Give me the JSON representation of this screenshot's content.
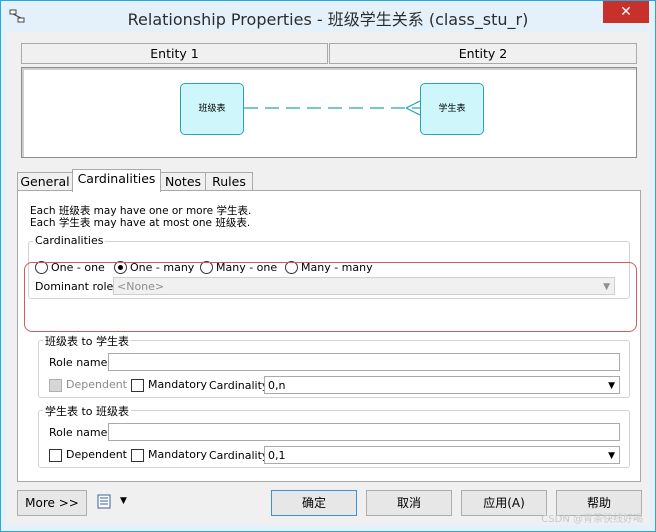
{
  "window": {
    "title": "Relationship Properties - 班级学生关系 (class_stu_r)",
    "close_glyph": "✕"
  },
  "entities": {
    "entity1_header": "Entity 1",
    "entity2_header": "Entity 2",
    "entity1_name": "班级表",
    "entity2_name": "学生表"
  },
  "tabs": [
    {
      "label": "General"
    },
    {
      "label": "Cardinalities"
    },
    {
      "label": "Notes"
    },
    {
      "label": "Rules"
    }
  ],
  "active_tab": "Cardinalities",
  "description": {
    "line1": "Each 班级表 may have one or more 学生表.",
    "line2": "Each 学生表 may have at most one 班级表."
  },
  "cardinalities": {
    "group_label": "Cardinalities",
    "options": [
      {
        "label": "One - one",
        "checked": false
      },
      {
        "label": "One - many",
        "checked": true
      },
      {
        "label": "Many - one",
        "checked": false
      },
      {
        "label": "Many - many",
        "checked": false
      }
    ],
    "dominant_role_label": "Dominant role:",
    "dominant_role_value": "<None>"
  },
  "role1": {
    "group_label": "班级表 to 学生表",
    "role_name_label": "Role name:",
    "role_name_value": "",
    "dependent_label": "Dependent",
    "dependent_enabled": false,
    "mandatory_label": "Mandatory",
    "cardinality_label": "Cardinality:",
    "cardinality_value": "0,n"
  },
  "role2": {
    "group_label": "学生表 to 班级表",
    "role_name_label": "Role name:",
    "role_name_value": "",
    "dependent_label": "Dependent",
    "mandatory_label": "Mandatory",
    "cardinality_label": "Cardinality:",
    "cardinality_value": "0,1"
  },
  "buttons": {
    "more": "More >>",
    "ok": "确定",
    "cancel": "取消",
    "apply": "应用(A)",
    "help": "帮助"
  },
  "watermark": "CSDN @青茶快线好喝",
  "colors": {
    "accent": "#23a8e0",
    "entity_fill": "#cff6fb",
    "entity_border": "#22a7b5",
    "highlight": "#d25a5a"
  }
}
